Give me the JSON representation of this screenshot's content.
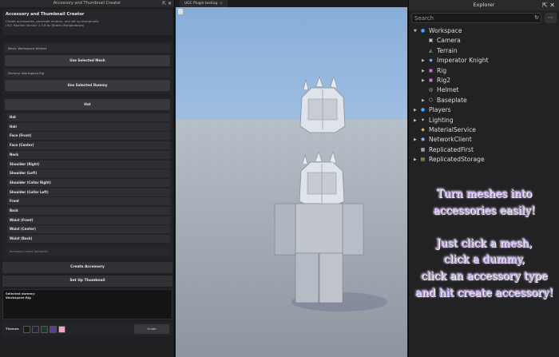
{
  "left_panel": {
    "window_title": "Accessory and Thumbnail Creator",
    "header": {
      "title": "Accessory and Thumbnail Creator",
      "line1": "Create accessories, generate renders, and set up thumbnails.",
      "line2": "UGC Pipeline Version 1.3.8 by @devt (Morgandown)"
    },
    "mesh_field": "Mesh: Workspace.Helmet",
    "use_mesh_label": "Use Selected Mesh",
    "dummy_field": "Dummy: Workspace.Rig",
    "use_dummy_label": "Use Selected Dummy",
    "selected_type": "Hat",
    "accessory_types": [
      "Hat",
      "Hair",
      "Face (Front)",
      "Face (Center)",
      "Neck",
      "Shoulder (Right)",
      "Shoulder (Left)",
      "Shoulder (Collar Right)",
      "Shoulder (Collar Left)",
      "Front",
      "Back",
      "Waist (Front)",
      "Waist (Center)",
      "Waist (Back)"
    ],
    "name_placeholder": "Accessory name (optional)",
    "create_label": "Create Accessory",
    "thumbnail_label": "Set Up Thumbnail",
    "status_line1": "Selected dummy:",
    "status_line2": "Workspace.Rig",
    "themes_label": "Themes",
    "theme_colors": [
      "#1a1a1a",
      "#1e2a3a",
      "#1f3a2a",
      "#5a3c9e",
      "#f2a6c8"
    ],
    "guide_label": "Guide"
  },
  "viewport": {
    "tab_label": "UGC Plugin testing",
    "tab_close": "×"
  },
  "explorer": {
    "title": "Explorer",
    "search_placeholder": "Search",
    "items": [
      {
        "label": "Workspace",
        "icon": "workspace-icon",
        "indent": 0,
        "arrow": "▼"
      },
      {
        "label": "Camera",
        "icon": "camera-icon",
        "indent": 1,
        "arrow": ""
      },
      {
        "label": "Terrain",
        "icon": "terrain-icon",
        "indent": 1,
        "arrow": ""
      },
      {
        "label": "Imperator Knight",
        "icon": "model-icon",
        "indent": 1,
        "arrow": "▶"
      },
      {
        "label": "Rig",
        "icon": "rig-icon",
        "indent": 1,
        "arrow": "▶"
      },
      {
        "label": "Rig2",
        "icon": "rig-icon",
        "indent": 1,
        "arrow": "▶"
      },
      {
        "label": "Helmet",
        "icon": "meshpart-icon",
        "indent": 1,
        "arrow": ""
      },
      {
        "label": "Baseplate",
        "icon": "part-icon",
        "indent": 1,
        "arrow": "▶"
      },
      {
        "label": "Players",
        "icon": "players-icon",
        "indent": 0,
        "arrow": "▶"
      },
      {
        "label": "Lighting",
        "icon": "lighting-icon",
        "indent": 0,
        "arrow": "▶"
      },
      {
        "label": "MaterialService",
        "icon": "material-icon",
        "indent": 0,
        "arrow": ""
      },
      {
        "label": "NetworkClient",
        "icon": "network-icon",
        "indent": 0,
        "arrow": "▶"
      },
      {
        "label": "ReplicatedFirst",
        "icon": "replicated-first-icon",
        "indent": 0,
        "arrow": ""
      },
      {
        "label": "ReplicatedStorage",
        "icon": "replicated-storage-icon",
        "indent": 0,
        "arrow": "▶"
      }
    ],
    "promo_lines": [
      "Turn meshes into",
      "accessories easily!",
      "",
      "Just click a mesh,",
      "click a dummy,",
      "click an accessory type",
      "and hit create accessory!"
    ]
  },
  "colors": {
    "promo_text": "#c9a4ff",
    "sky_top": "#8fb3dd",
    "sky_bottom": "#c9dbef",
    "floor": "#9aa3ad"
  }
}
